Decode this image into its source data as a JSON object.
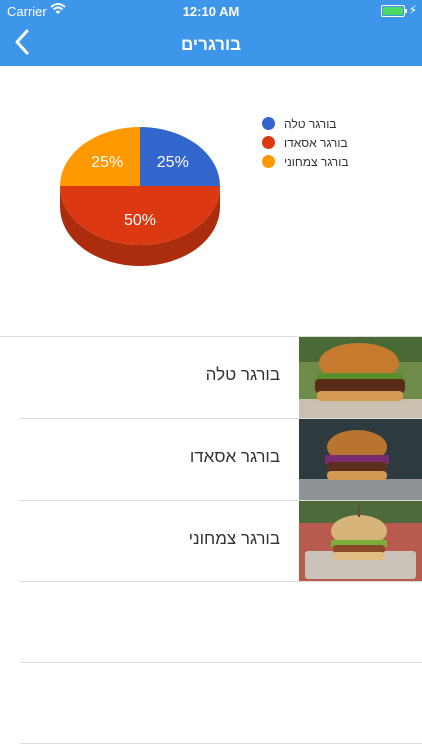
{
  "status_bar": {
    "carrier": "Carrier",
    "time": "12:10 AM"
  },
  "nav": {
    "title": "בורגרים",
    "back_icon": "chevron-left-icon"
  },
  "chart_data": {
    "type": "pie",
    "title": "",
    "slices": [
      {
        "label": "בורגר טלה",
        "value": 25,
        "display": "25%",
        "color": "#3366cc"
      },
      {
        "label": "בורגר אסאדו",
        "value": 50,
        "display": "50%",
        "color": "#dc3912"
      },
      {
        "label": "בורגר צמחוני",
        "value": 25,
        "display": "25%",
        "color": "#ff9900"
      }
    ],
    "legend_position": "right",
    "style": "3d"
  },
  "legend": [
    "בורגר טלה",
    "בורגר אסאדו",
    "בורגר צמחוני"
  ],
  "list": [
    {
      "label": "בורגר טלה",
      "image": "burger-photo"
    },
    {
      "label": "בורגר אסאדו",
      "image": "burger-photo"
    },
    {
      "label": "בורגר צמחוני",
      "image": "burger-photo"
    }
  ]
}
